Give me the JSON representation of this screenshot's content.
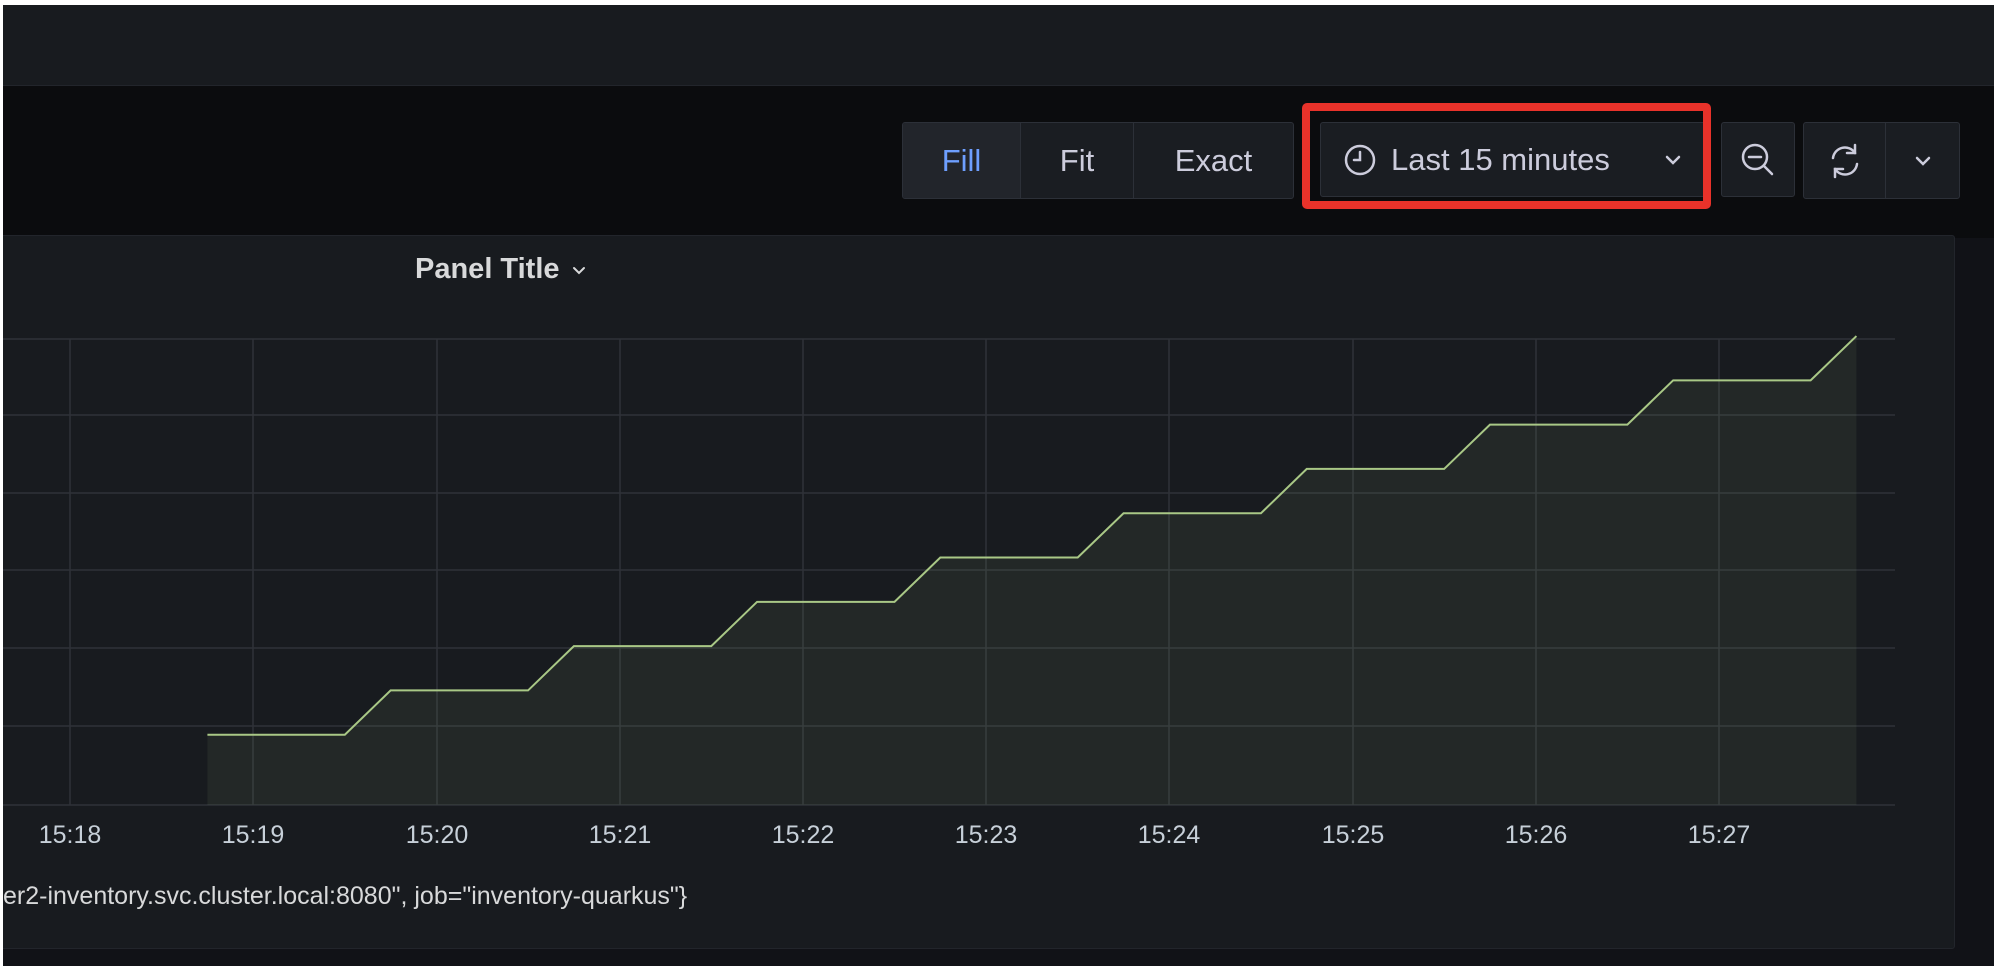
{
  "toolbar": {
    "view_modes": [
      {
        "label": "Fill",
        "active": true
      },
      {
        "label": "Fit",
        "active": false
      },
      {
        "label": "Exact",
        "active": false
      }
    ],
    "time_picker": {
      "label": "Last 15 minutes",
      "icon": "clock-icon"
    },
    "zoom_out_icon": "zoom-out-icon",
    "refresh_icon": "refresh-icon",
    "refresh_dropdown_icon": "chevron-down-icon"
  },
  "panel": {
    "title": "Panel Title",
    "legend": "er2-inventory.svc.cluster.local:8080\", job=\"inventory-quarkus\"}"
  },
  "colors": {
    "accent": "#6e9fff",
    "series": "#a9c886",
    "highlight": "#e8322a",
    "background": "#111217"
  },
  "chart_data": {
    "type": "line",
    "x_ticks": [
      "15:18",
      "15:19",
      "15:20",
      "15:21",
      "15:22",
      "15:23",
      "15:24",
      "15:25",
      "15:26",
      "15:27"
    ],
    "y_ticks": [],
    "grid": true,
    "series": [
      {
        "x": [
          "15:18:45",
          "15:19:30",
          "15:19:45",
          "15:20:30",
          "15:20:45",
          "15:21:30",
          "15:21:45",
          "15:22:30",
          "15:22:45",
          "15:23:30",
          "15:23:45",
          "15:24:30",
          "15:24:45",
          "15:25:30",
          "15:25:45",
          "15:26:30",
          "15:26:45",
          "15:27:30",
          "15:27:45"
        ],
        "values": [
          1,
          1,
          2,
          2,
          3,
          3,
          4,
          4,
          5,
          5,
          6,
          6,
          7,
          7,
          8,
          8,
          9,
          9,
          10
        ]
      }
    ]
  }
}
